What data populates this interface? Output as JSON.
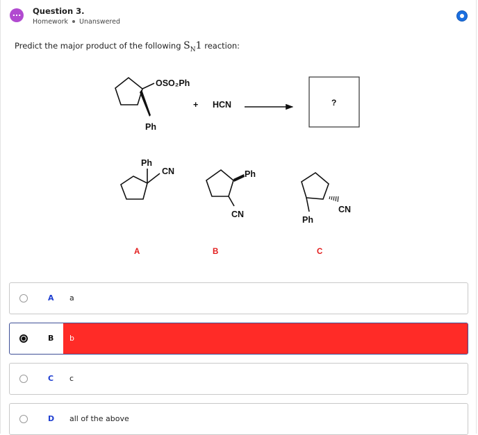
{
  "header": {
    "title": "Question 3.",
    "category": "Homework",
    "status": "Unanswered",
    "avatar_glyph": "..."
  },
  "question": {
    "prompt_before": "Predict the major product of the following",
    "sn_s": "S",
    "sn_n": "N",
    "sn_1": "1",
    "prompt_after": "reaction:"
  },
  "reaction": {
    "leaving_group": "OSO₂Ph",
    "substituent": "Ph",
    "plus": "+",
    "reagent": "HCN",
    "product_placeholder": "?"
  },
  "products": {
    "a": {
      "top": "Ph",
      "side": "CN",
      "label": "A"
    },
    "b": {
      "top": "Ph",
      "bottom": "CN",
      "label": "B"
    },
    "c": {
      "bottom": "Ph",
      "side": "CN",
      "label": "C"
    }
  },
  "options": [
    {
      "letter": "A",
      "text": "a",
      "selected": false
    },
    {
      "letter": "B",
      "text": "b",
      "selected": true
    },
    {
      "letter": "C",
      "text": "c",
      "selected": false
    },
    {
      "letter": "D",
      "text": "all of the above",
      "selected": false
    }
  ],
  "colors": {
    "selected_fill": "#ff2b27",
    "label_red": "#e21b1b",
    "label_blue": "#1f3fd1",
    "avatar": "#b14ad0",
    "flag": "#1b6fe0"
  }
}
